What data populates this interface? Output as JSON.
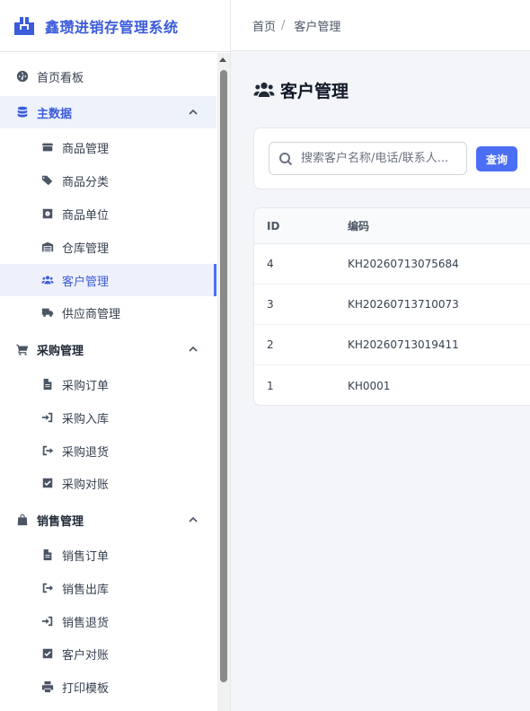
{
  "app": {
    "title": "鑫瓒进销存管理系统"
  },
  "sidebar": {
    "items": [
      {
        "label": "首页看板",
        "icon": "dashboard-icon"
      },
      {
        "label": "主数据",
        "icon": "database-icon"
      },
      {
        "label": "商品管理",
        "icon": "box-icon"
      },
      {
        "label": "商品分类",
        "icon": "tags-icon"
      },
      {
        "label": "商品单位",
        "icon": "scale-icon"
      },
      {
        "label": "仓库管理",
        "icon": "warehouse-icon"
      },
      {
        "label": "客户管理",
        "icon": "users-icon"
      },
      {
        "label": "供应商管理",
        "icon": "truck-icon"
      },
      {
        "label": "采购管理",
        "icon": "cart-icon"
      },
      {
        "label": "采购订单",
        "icon": "file-icon"
      },
      {
        "label": "采购入库",
        "icon": "sign-in-icon"
      },
      {
        "label": "采购退货",
        "icon": "sign-out-icon"
      },
      {
        "label": "采购对账",
        "icon": "check-square-icon"
      },
      {
        "label": "销售管理",
        "icon": "bag-icon"
      },
      {
        "label": "销售订单",
        "icon": "file-icon"
      },
      {
        "label": "销售出库",
        "icon": "sign-out-icon"
      },
      {
        "label": "销售退货",
        "icon": "sign-in-icon"
      },
      {
        "label": "客户对账",
        "icon": "check-square-icon"
      },
      {
        "label": "打印模板",
        "icon": "print-icon"
      }
    ]
  },
  "breadcrumb": {
    "home": "首页",
    "separator": "/",
    "current": "客户管理"
  },
  "page": {
    "title": "客户管理"
  },
  "search": {
    "placeholder": "搜索客户名称/电话/联系人...",
    "button_label": "查询"
  },
  "table": {
    "columns": [
      "ID",
      "编码"
    ],
    "rows": [
      {
        "id": "4",
        "code": "KH20260713075684"
      },
      {
        "id": "3",
        "code": "KH20260713710073"
      },
      {
        "id": "2",
        "code": "KH20260713019411"
      },
      {
        "id": "1",
        "code": "KH0001"
      }
    ]
  },
  "colors": {
    "accent": "#4c6ef5",
    "brand": "#3b5bdb",
    "active_bg": "#eef1fb"
  }
}
